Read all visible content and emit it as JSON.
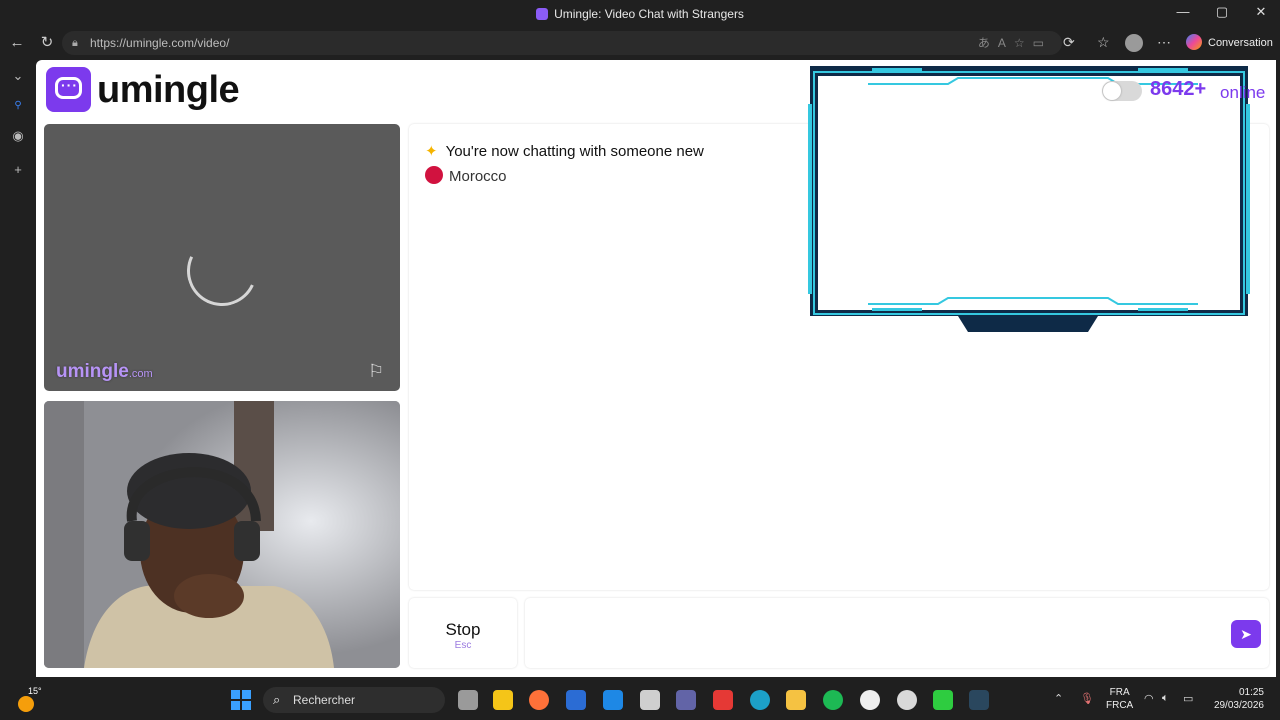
{
  "window": {
    "title": "Umingle: Video Chat with Strangers",
    "min": "—",
    "max": "▢",
    "close": "✕"
  },
  "browser": {
    "url": "https://umingle.com/video/",
    "conversation_label": "Conversation"
  },
  "site": {
    "logo_text": "umingle",
    "watermark": "umingle",
    "watermark_suffix": ".com",
    "online_count": "8642+",
    "online_label": "online"
  },
  "chat": {
    "status_message": "You're now chatting with someone new",
    "country": "Morocco"
  },
  "controls": {
    "stop_label": "Stop",
    "stop_shortcut": "Esc",
    "message_placeholder": ""
  },
  "taskbar": {
    "weather_temp": "15°",
    "search_label": "Rechercher",
    "lang_top": "FRA",
    "lang_bottom": "FRCA",
    "time": "01:25",
    "date": "29/03/2026"
  },
  "colors": {
    "accent": "#7c3aed",
    "country_dot": "#d1123f",
    "frame_cyan": "#35c8e0",
    "frame_navy": "#0e2a47"
  }
}
